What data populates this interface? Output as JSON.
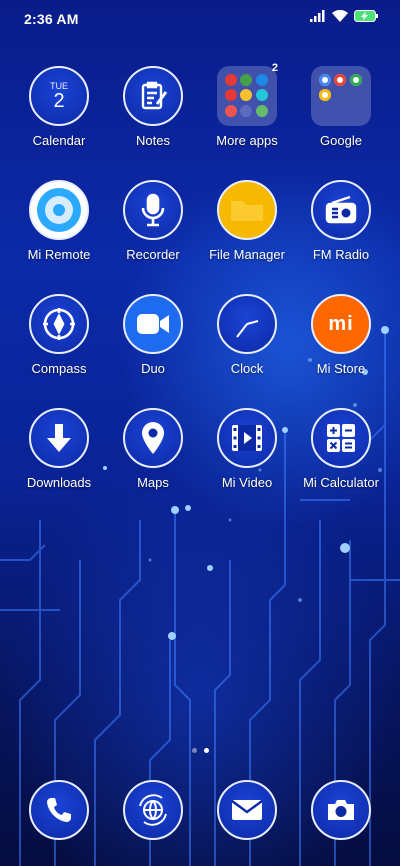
{
  "status_bar": {
    "time": "2:36 AM",
    "icons": [
      "signal-icon",
      "wifi-icon",
      "battery-charging-icon"
    ]
  },
  "calendar": {
    "weekday": "TUE",
    "day": "2"
  },
  "apps": [
    {
      "label": "Calendar",
      "icon": "calendar-icon"
    },
    {
      "label": "Notes",
      "icon": "notes-icon"
    },
    {
      "label": "More apps",
      "icon": "folder-icon",
      "badge": "2"
    },
    {
      "label": "Google",
      "icon": "folder-icon"
    },
    {
      "label": "Mi Remote",
      "icon": "remote-icon"
    },
    {
      "label": "Recorder",
      "icon": "microphone-icon"
    },
    {
      "label": "File Manager",
      "icon": "file-manager-icon"
    },
    {
      "label": "FM Radio",
      "icon": "radio-icon"
    },
    {
      "label": "Compass",
      "icon": "compass-icon"
    },
    {
      "label": "Duo",
      "icon": "video-camera-icon"
    },
    {
      "label": "Clock",
      "icon": "clock-icon"
    },
    {
      "label": "Mi Store",
      "icon": "mi-logo-icon"
    },
    {
      "label": "Downloads",
      "icon": "download-arrow-icon"
    },
    {
      "label": "Maps",
      "icon": "map-pin-icon"
    },
    {
      "label": "Mi Video",
      "icon": "film-icon"
    },
    {
      "label": "Mi Calculator",
      "icon": "calculator-icon"
    }
  ],
  "mi_store_logo": "mi",
  "page_indicator": {
    "pages": 2,
    "current": 2
  },
  "dock": [
    {
      "name": "phone-icon"
    },
    {
      "name": "browser-globe-icon"
    },
    {
      "name": "messaging-icon"
    },
    {
      "name": "camera-icon"
    }
  ],
  "colors": {
    "background_top": "#0a1c8a",
    "background_bottom": "#050d40",
    "icon_fill": "#0d2aa6",
    "icon_border": "#e8eeff",
    "file_manager_yellow": "#f6b800",
    "mi_store_orange": "#ff6700"
  }
}
